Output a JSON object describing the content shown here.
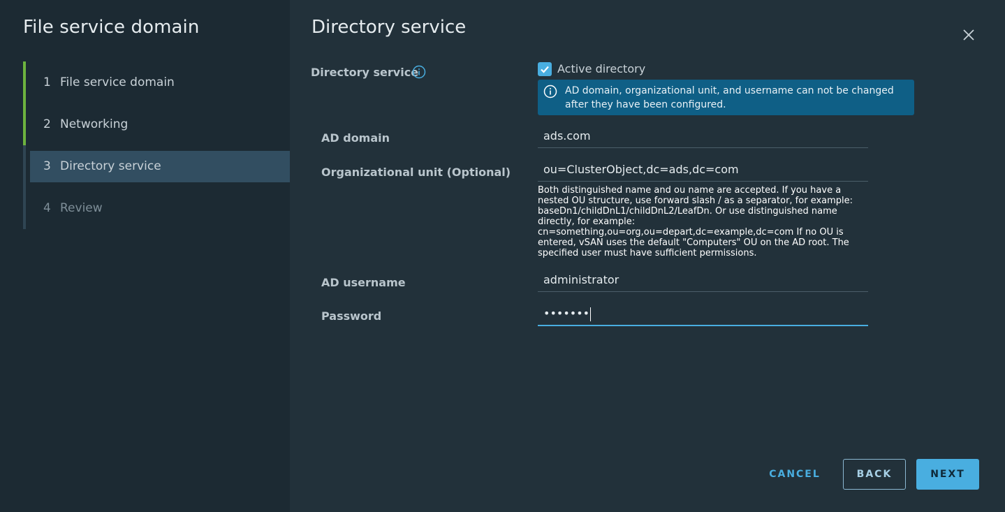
{
  "sidebar": {
    "title": "File service domain",
    "steps": [
      {
        "num": "1",
        "label": "File service domain",
        "state": "done"
      },
      {
        "num": "2",
        "label": "Networking",
        "state": "done"
      },
      {
        "num": "3",
        "label": "Directory service",
        "state": "active"
      },
      {
        "num": "4",
        "label": "Review",
        "state": "pending"
      }
    ]
  },
  "main": {
    "title": "Directory service",
    "close_icon": "close-icon",
    "directory_service_label": "Directory service",
    "info_icon": "info-circle-icon",
    "active_directory": {
      "label": "Active directory",
      "checked": true
    },
    "alert_text": "AD domain, organizational unit, and username can not be changed after they have been configured.",
    "fields": {
      "ad_domain": {
        "label": "AD domain",
        "value": "ads.com"
      },
      "ou": {
        "label": "Organizational unit (Optional)",
        "value": "ou=ClusterObject,dc=ads,dc=com"
      },
      "ou_help": "Both distinguished name and ou name are accepted. If you have a nested OU structure, use forward slash / as a separator, for example: baseDn1/childDnL1/childDnL2/LeafDn. Or use distinguished name directly, for example: cn=something,ou=org,ou=depart,dc=example,dc=com If no OU is entered, vSAN uses the default \"Computers\" OU on the AD root. The specified user must have sufficient permissions.",
      "ad_username": {
        "label": "AD username",
        "value": "administrator"
      },
      "password": {
        "label": "Password",
        "value": "•••••••"
      }
    }
  },
  "footer": {
    "cancel": "CANCEL",
    "back": "BACK",
    "next": "NEXT"
  },
  "colors": {
    "accent": "#49aee0",
    "done_step": "#6db33f",
    "alert_bg": "#0f5f86"
  }
}
